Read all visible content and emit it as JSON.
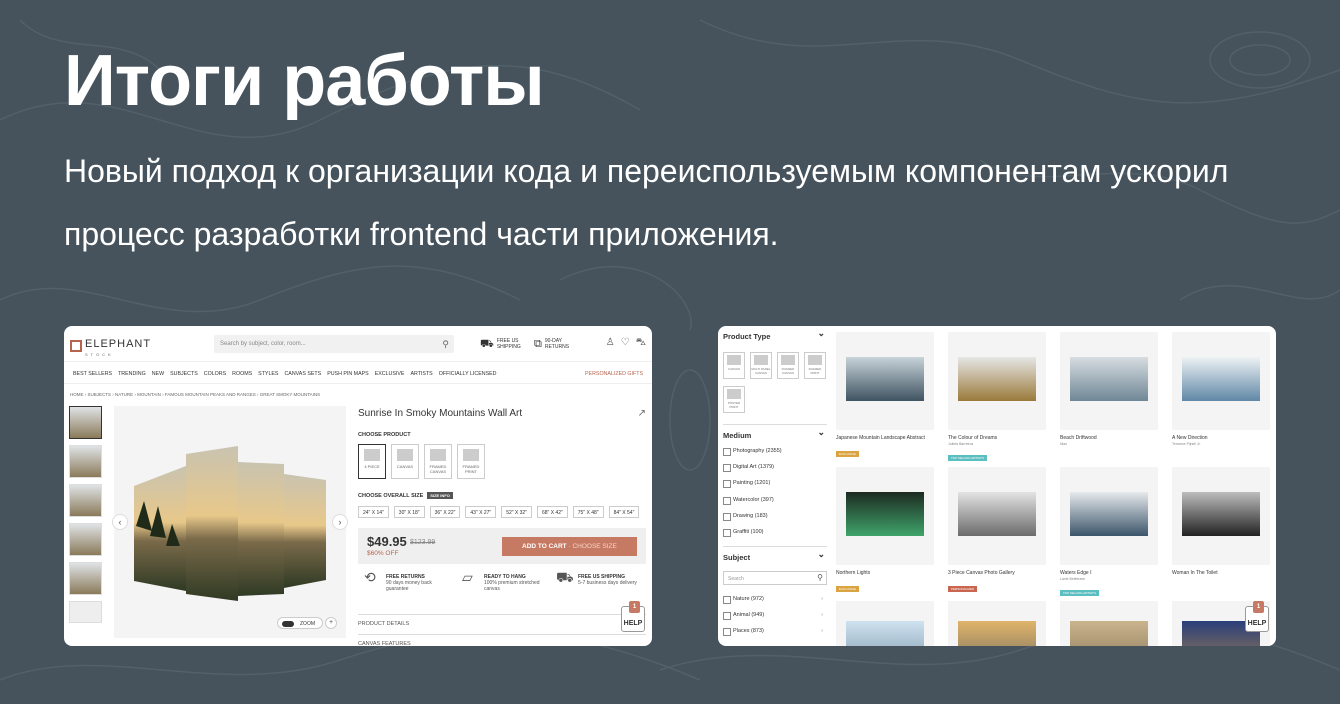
{
  "slide": {
    "title": "Итоги работы",
    "subtitle": "Новый подход к организации кода и переиспользуемым компонентам ускорил процесс разработки frontend части приложения."
  },
  "product_page": {
    "logo": {
      "name": "ELEPHANT",
      "tagline": "STOCK"
    },
    "search_placeholder": "Search by subject, color, room...",
    "header_info": [
      "FREE US SHIPPING",
      "90-DAY RETURNS"
    ],
    "nav": [
      "BEST SELLERS",
      "TRENDING",
      "NEW",
      "SUBJECTS",
      "COLORS",
      "ROOMS",
      "STYLES",
      "CANVAS SETS",
      "PUSH PIN MAPS",
      "EXCLUSIVE",
      "ARTISTS",
      "OFFICIALLY LICENSED"
    ],
    "nav_right": "PERSONALIZED GIFTS",
    "breadcrumb": "HOME › SUBJECTS › NATURE › MOUNTAIN › FAMOUS MOUNTAIN PEAKS AND RANGES › GREAT SMOKY MOUNTAINS",
    "title": "Sunrise In Smoky Mountains Wall Art",
    "choose_product_label": "CHOOSE PRODUCT",
    "product_options": [
      "4 PIECE",
      "CANVAS",
      "FRAMED CANVAS",
      "FRAMED PRINT"
    ],
    "choose_size_label": "CHOOSE OVERALL SIZE",
    "size_info_label": "SIZE INFO",
    "sizes": [
      "24\" X 14\"",
      "30\" X 18\"",
      "36\" X 22\"",
      "43\" X 27\"",
      "52\" X 32\"",
      "68\" X 42\"",
      "75\" X 48\"",
      "84\" X 54\""
    ],
    "price": "$49.95",
    "old_price": "$123.99",
    "discount": "$60% OFF",
    "add_to_cart": "ADD TO CART",
    "choose_size_hint": "· CHOOSE SIZE",
    "zoom_label": "ZOOM",
    "features": [
      {
        "title": "FREE RETURNS",
        "text": "90 days money back guarantee"
      },
      {
        "title": "READY TO HANG",
        "text": "100% premium stretched canvas"
      },
      {
        "title": "FREE US SHIPPING",
        "text": "5-7 business days delivery"
      }
    ],
    "accordion": [
      "PRODUCT DETAILS",
      "CANVAS FEATURES"
    ],
    "help_label": "HELP",
    "help_count": "1"
  },
  "catalog_page": {
    "product_type_label": "Product Type",
    "product_types": [
      "CANVAS",
      "MULTI PANEL CANVAS",
      "FRAMED CANVAS",
      "FRAMED PRINT",
      "POSTER PRINT"
    ],
    "medium_label": "Medium",
    "medium": [
      "Photography (2355)",
      "Digital Art (1379)",
      "Painting (1201)",
      "Watercolor (397)",
      "Drawing (183)",
      "Graffiti (100)"
    ],
    "subject_label": "Subject",
    "subject_search_placeholder": "Search",
    "subjects": [
      "Nature (972)",
      "Animal (949)",
      "Places (873)"
    ],
    "cards": [
      {
        "name": "Japanese Mountain Landscape Abstract",
        "by": "",
        "badge": "EXCLUSIVE",
        "badge_color": "#d9a441"
      },
      {
        "name": "The Colour of Dreams",
        "by": "Julieta Barreiros",
        "badge": "TOP SELLING ARTISTS",
        "badge_color": "#5bbfc2"
      },
      {
        "name": "Beach Driftwood",
        "by": "Nian",
        "badge": "",
        "badge_color": ""
      },
      {
        "name": "A New Direction",
        "by": "Terrance Pijnell Jr.",
        "badge": "",
        "badge_color": ""
      },
      {
        "name": "Northern Lights",
        "by": "",
        "badge": "EXCLUSIVE",
        "badge_color": "#d9a441"
      },
      {
        "name": "3 Piece Canvas Photo Gallery",
        "by": "",
        "badge": "PERSONALIZED",
        "badge_color": "#c8664f"
      },
      {
        "name": "Waters Edge I",
        "by": "Lanie Belletrave",
        "badge": "TOP SELLING ARTISTS",
        "badge_color": "#5bbfc2"
      },
      {
        "name": "Woman In The Toilet",
        "by": "",
        "badge": "",
        "badge_color": ""
      }
    ],
    "help_label": "HELP",
    "help_count": "1"
  },
  "colors": {
    "background": "#46535c",
    "accent": "#c77a63"
  }
}
